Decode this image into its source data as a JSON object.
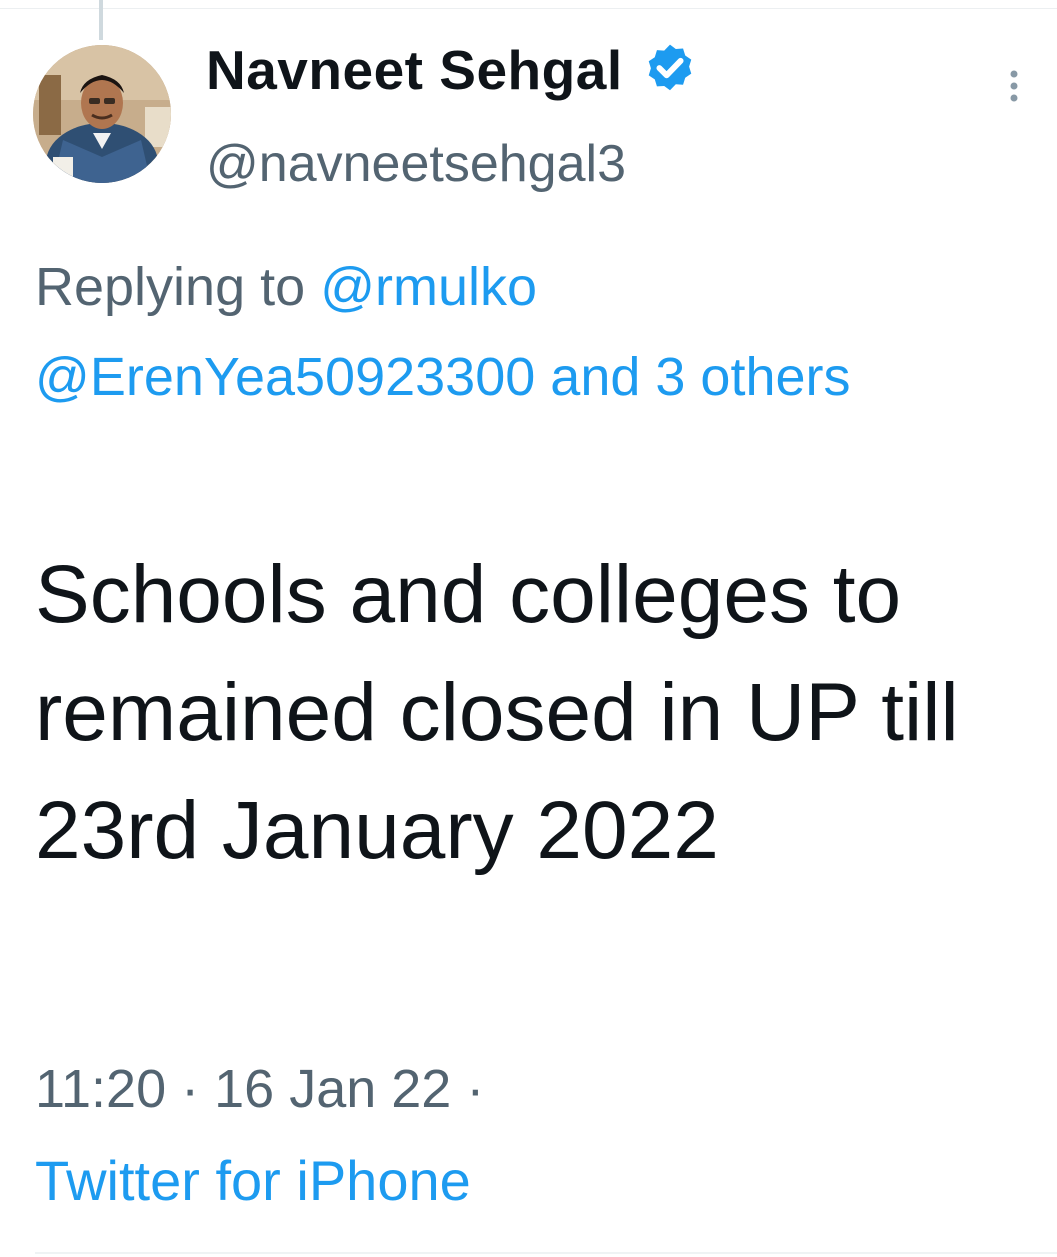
{
  "author": {
    "display_name": "Navneet Sehgal",
    "handle": "@navneetsehgal3",
    "verified_icon": "verified-badge-icon",
    "verified_color": "#1d9bf0"
  },
  "reply": {
    "prefix": "Replying to",
    "mention_1": "@rmulko",
    "mention_2": "@ErenYea50923300",
    "others": "and 3 others"
  },
  "tweet": {
    "text": "Schools and colleges to remained closed in UP till 23rd January 2022"
  },
  "meta": {
    "time": "11:20",
    "separator": "·",
    "date": "16 Jan 22",
    "separator_2": "·",
    "source": "Twitter for iPhone"
  },
  "colors": {
    "text_primary": "#0f1419",
    "text_secondary": "#536471",
    "accent": "#1d9bf0"
  }
}
